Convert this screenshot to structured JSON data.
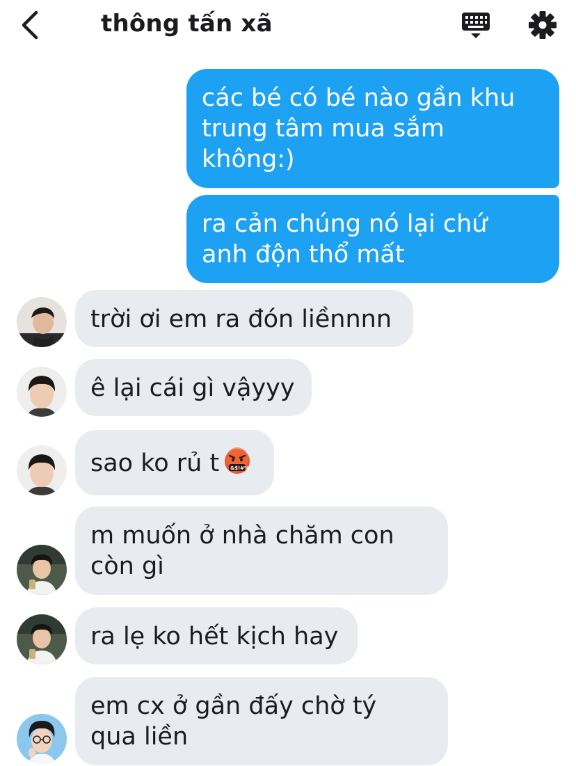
{
  "header": {
    "title": "thông tấn xã",
    "back_icon": "chevron-left-icon",
    "keyboard_icon": "keyboard-icon",
    "settings_icon": "gear-icon"
  },
  "colors": {
    "outgoing_bubble": "#1da1f2",
    "incoming_bubble": "#e8ecf0",
    "text_dark": "#1c1c1e"
  },
  "messages": [
    {
      "direction": "outgoing",
      "lines": [
        "các bé có bé nào gần khu",
        "trung tâm mua sắm",
        "không:)"
      ]
    },
    {
      "direction": "outgoing",
      "lines": [
        "ra cản chúng nó lại chứ",
        "anh độn thổ mất"
      ]
    },
    {
      "direction": "incoming",
      "avatar": "avatar-1",
      "lines": [
        "trời ơi em ra đón liềnnnn"
      ]
    },
    {
      "direction": "incoming",
      "avatar": "avatar-2",
      "lines": [
        "ê lại cái gì vậyyy"
      ]
    },
    {
      "direction": "incoming",
      "avatar": "avatar-2",
      "lines": [
        "sao ko rủ t"
      ],
      "emoji": "face-with-symbols-on-mouth-emoji"
    },
    {
      "direction": "incoming",
      "avatar": "avatar-3",
      "lines": [
        "m muốn ở nhà chăm con",
        "còn gì"
      ]
    },
    {
      "direction": "incoming",
      "avatar": "avatar-3",
      "lines": [
        "ra lẹ ko hết kịch hay"
      ]
    },
    {
      "direction": "incoming",
      "avatar": "avatar-4",
      "lines": [
        "em cx ở gần đấy chờ tý",
        "qua liền"
      ]
    }
  ]
}
